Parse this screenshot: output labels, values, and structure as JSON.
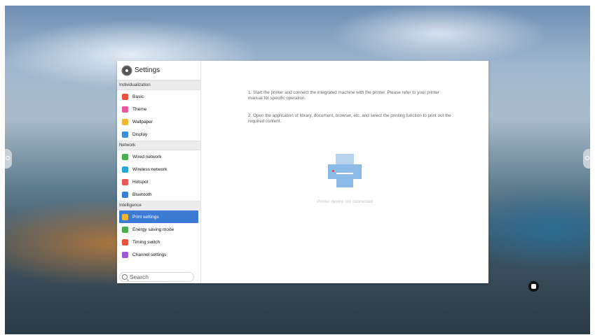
{
  "settings": {
    "title": "Settings",
    "sections": [
      {
        "label": "Individualization",
        "items": [
          {
            "label": "Basic",
            "icon": "basic-icon",
            "color": "#e8543f"
          },
          {
            "label": "Theme",
            "icon": "theme-icon",
            "color": "#e85aa0"
          },
          {
            "label": "Wallpaper",
            "icon": "wallpaper-icon",
            "color": "#f2b632"
          },
          {
            "label": "Display",
            "icon": "display-icon",
            "color": "#3b8fd9"
          }
        ]
      },
      {
        "label": "Network",
        "items": [
          {
            "label": "Wired network",
            "icon": "wired-network-icon",
            "color": "#46b04a"
          },
          {
            "label": "Wireless network",
            "icon": "wifi-icon",
            "color": "#29a8d8"
          },
          {
            "label": "Hotspot",
            "icon": "hotspot-icon",
            "color": "#e85a5a"
          },
          {
            "label": "Bluetooth",
            "icon": "bluetooth-icon",
            "color": "#3a7fd6"
          }
        ]
      },
      {
        "label": "Intelligence",
        "items": [
          {
            "label": "Print settings",
            "icon": "print-icon",
            "color": "#f2b632",
            "active": true
          },
          {
            "label": "Energy saving mode",
            "icon": "energy-icon",
            "color": "#46b04a"
          },
          {
            "label": "Timing switch",
            "icon": "timing-icon",
            "color": "#e8543f"
          },
          {
            "label": "Channel settings",
            "icon": "channel-icon",
            "color": "#9a5bd1"
          }
        ]
      }
    ],
    "search_placeholder": "Search"
  },
  "print_panel": {
    "instruction_1": "1. Start the printer and connect the integrated machine with the printer. Please refer to your printer manual for specific operation.",
    "instruction_2": "2. Open the application of library, document, browser, etc. and select the printing function to print out the required content.",
    "status": "Printer device not connected"
  },
  "colors": {
    "active_item": "#3b7bd4",
    "printer_icon": "#8cbbe8"
  }
}
